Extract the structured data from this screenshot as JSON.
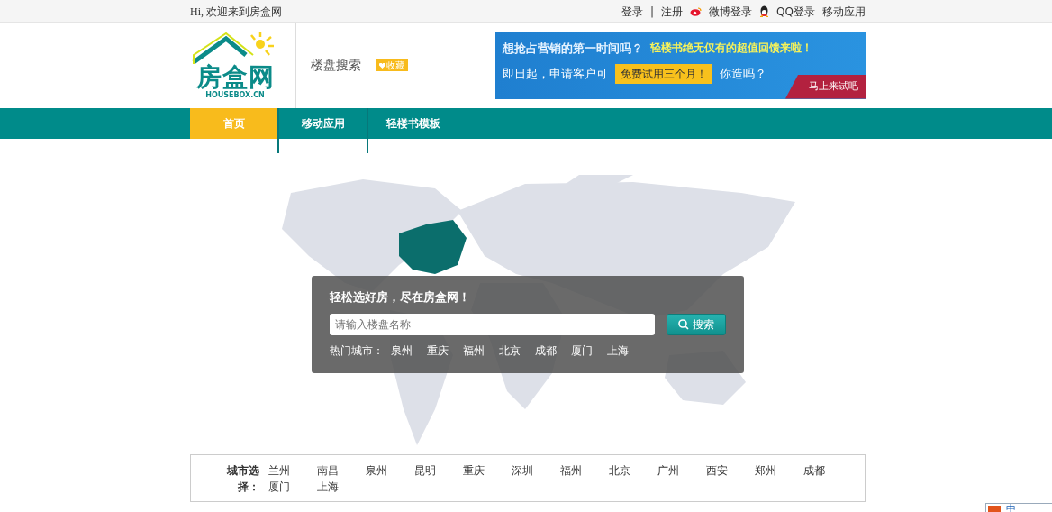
{
  "top_bar": {
    "greeting": "Hi, 欢迎来到房盒网",
    "links": [
      {
        "kind": "text",
        "label": "登录"
      },
      {
        "kind": "separator",
        "label": "|"
      },
      {
        "kind": "text",
        "label": "注册"
      },
      {
        "kind": "weibo",
        "label": "微博登录"
      },
      {
        "kind": "qq",
        "label": "QQ登录"
      },
      {
        "kind": "text",
        "label": "移动应用"
      }
    ]
  },
  "header": {
    "logo": {
      "name": "房盒网",
      "subtext": "HOUSEBOX.CN"
    },
    "page_title": "楼盘搜索",
    "favorite": "收藏",
    "banner": {
      "headline_1": "想抢占营销的第一时间吗？",
      "headline_2": "轻楼书绝无仅有的超值回馈来啦！",
      "line_1": "即日起，申请客户可",
      "highlight": "免费试用三个月！",
      "line_2": "你造吗？",
      "cta": "马上来试吧"
    }
  },
  "nav": [
    {
      "label": "首页",
      "selected": true
    },
    {
      "label": "移动应用",
      "selected": false
    },
    {
      "label": "轻楼书模板",
      "selected": false
    }
  ],
  "search_panel": {
    "title": "轻松选好房，尽在房盒网！",
    "placeholder": "请输入楼盘名称",
    "button": "搜索",
    "hot_label": "热门城市：",
    "cities": [
      "泉州",
      "重庆",
      "福州",
      "北京",
      "成都",
      "厦门",
      "上海"
    ]
  },
  "city_select": {
    "label": "城市选择：",
    "cities": [
      "兰州",
      "南昌",
      "泉州",
      "昆明",
      "重庆",
      "深圳",
      "福州",
      "北京",
      "广州",
      "西安",
      "郑州",
      "成都",
      "厦门",
      "上海"
    ]
  },
  "ime_bar": {
    "label": "中"
  }
}
